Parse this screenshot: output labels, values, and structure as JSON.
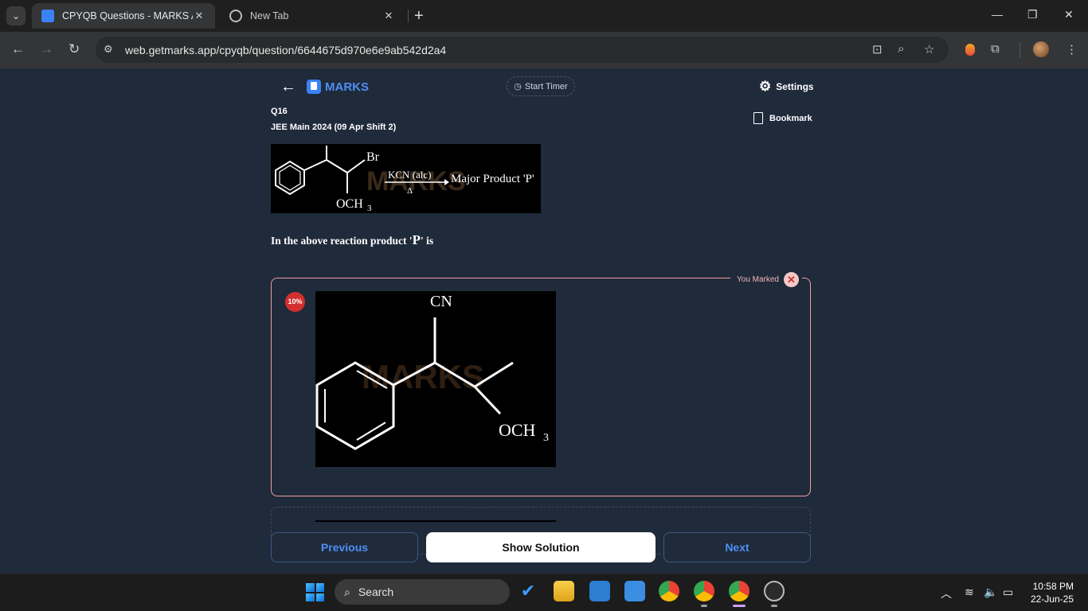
{
  "browser": {
    "tabs": [
      {
        "title": "CPYQB Questions - MARKS App",
        "active": true,
        "icon": "marks-favicon"
      },
      {
        "title": "New Tab",
        "active": false,
        "icon": "chrome-favicon"
      }
    ],
    "url": "web.getmarks.app/cpyqb/question/6644675d970e6e9ab542d2a4"
  },
  "header": {
    "logo": "MARKS",
    "timer_label": "Start Timer",
    "settings_label": "Settings"
  },
  "question": {
    "number": "Q16",
    "source": "JEE Main 2024 (09 Apr Shift 2)",
    "bookmark_label": "Bookmark",
    "image": {
      "br_label": "Br",
      "reagent": "KCN (alc)",
      "condition": "Δ",
      "product": "Major Product 'P'",
      "och3": "OCH",
      "sub": "3",
      "watermark": "MARKS"
    },
    "text_prefix": "In the above reaction product '",
    "text_var": "P",
    "text_suffix": "' is"
  },
  "option": {
    "marked_label": "You Marked",
    "percent": "10%",
    "image": {
      "cn": "CN",
      "och3": "OCH",
      "sub": "3",
      "watermark": "MARKS"
    }
  },
  "nav": {
    "previous": "Previous",
    "show_solution": "Show Solution",
    "next": "Next"
  },
  "taskbar": {
    "search_label": "Search",
    "time": "10:58 PM",
    "date": "22-Jun-25"
  },
  "colors": {
    "page_bg": "#1f2a3a",
    "accent": "#4f8ff7",
    "marked_border": "#f0a0a0",
    "percent_badge": "#d32f2f"
  }
}
